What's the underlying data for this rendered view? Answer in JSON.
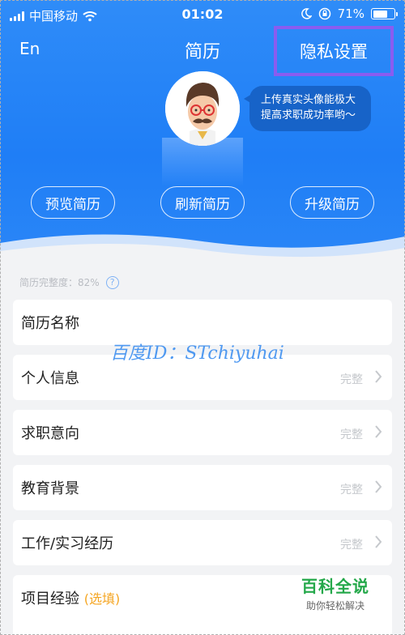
{
  "status_bar": {
    "carrier": "中国移动",
    "time": "01:02",
    "battery": "71%",
    "battery_level": 0.71
  },
  "nav": {
    "left": "En",
    "title": "简历",
    "right": "隐私设置"
  },
  "bubble": {
    "line1": "上传真实头像能极大",
    "line2": "提高求职成功率哟～"
  },
  "actions": {
    "preview": "预览简历",
    "refresh": "刷新简历",
    "upgrade": "升级简历"
  },
  "progress": {
    "label": "简历完整度：82%",
    "help": "?"
  },
  "sections": [
    {
      "label": "简历名称",
      "status": ""
    },
    {
      "label": "个人信息",
      "status": "完整"
    },
    {
      "label": "求职意向",
      "status": "完整"
    },
    {
      "label": "教育背景",
      "status": "完整"
    },
    {
      "label": "工作/实习经历",
      "status": "完整"
    },
    {
      "label": "项目经验",
      "optional": "(选填)"
    }
  ],
  "watermark": "百度ID：STchiyuhai",
  "baike": {
    "title": "百科全说",
    "subtitle": "助你轻松解决"
  },
  "colors": {
    "header_blue": "#2a86f7",
    "highlight_box": "#8a5cf0",
    "optional": "#f5a623",
    "baike_green": "#24a84a"
  }
}
